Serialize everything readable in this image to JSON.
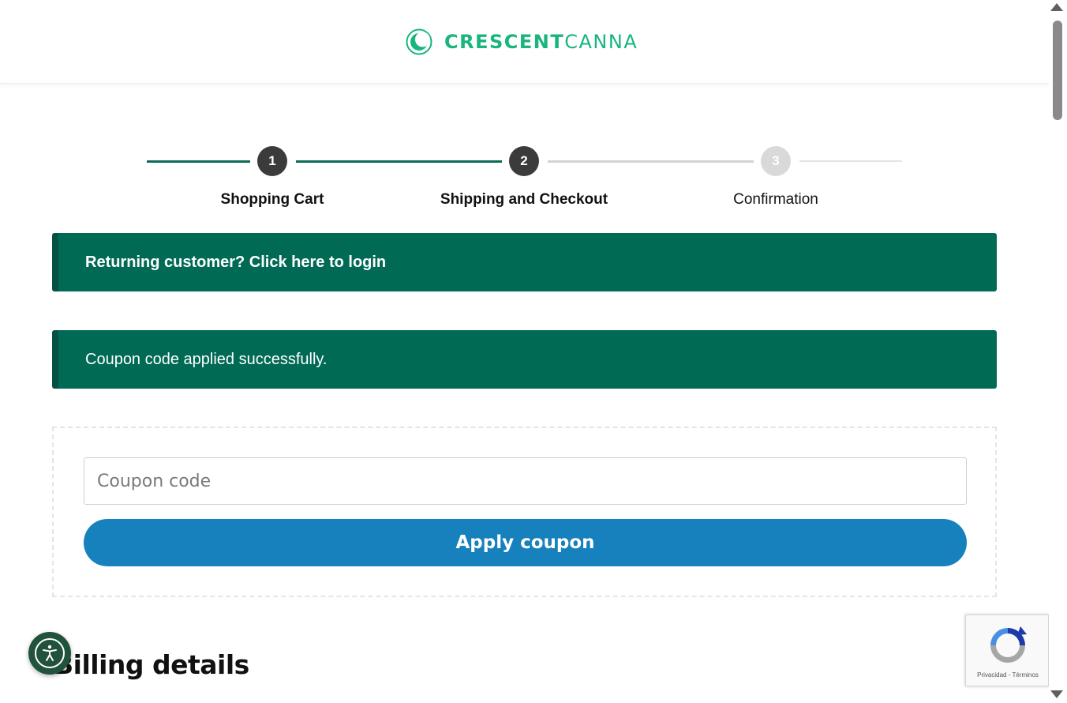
{
  "brand": {
    "name_bold": "CRESCENT",
    "name_light": "CANNA",
    "color": "#18b57d",
    "icon": "crescent-moon-logo"
  },
  "steps": [
    {
      "number": "1",
      "label": "Shopping Cart",
      "state": "completed"
    },
    {
      "number": "2",
      "label": "Shipping and Checkout",
      "state": "active"
    },
    {
      "number": "3",
      "label": "Confirmation",
      "state": "pending"
    }
  ],
  "colors": {
    "step_active": "#3b3b3b",
    "step_pending": "#d9d9d9",
    "line_active": "#0b6a55",
    "line_pending": "#d3d3d3",
    "notice_bg": "#006a55",
    "button_bg": "#1681bd"
  },
  "notices": {
    "login": "Returning customer? Click here to login",
    "coupon_success": "Coupon code applied successfully."
  },
  "coupon": {
    "placeholder": "Coupon code",
    "value": "",
    "button_label": "Apply coupon"
  },
  "billing": {
    "title": "Billing details"
  },
  "accessibility": {
    "icon": "accessibility-person-icon"
  },
  "recaptcha": {
    "privacy": "Privacidad",
    "separator": " - ",
    "terms": "Términos"
  }
}
